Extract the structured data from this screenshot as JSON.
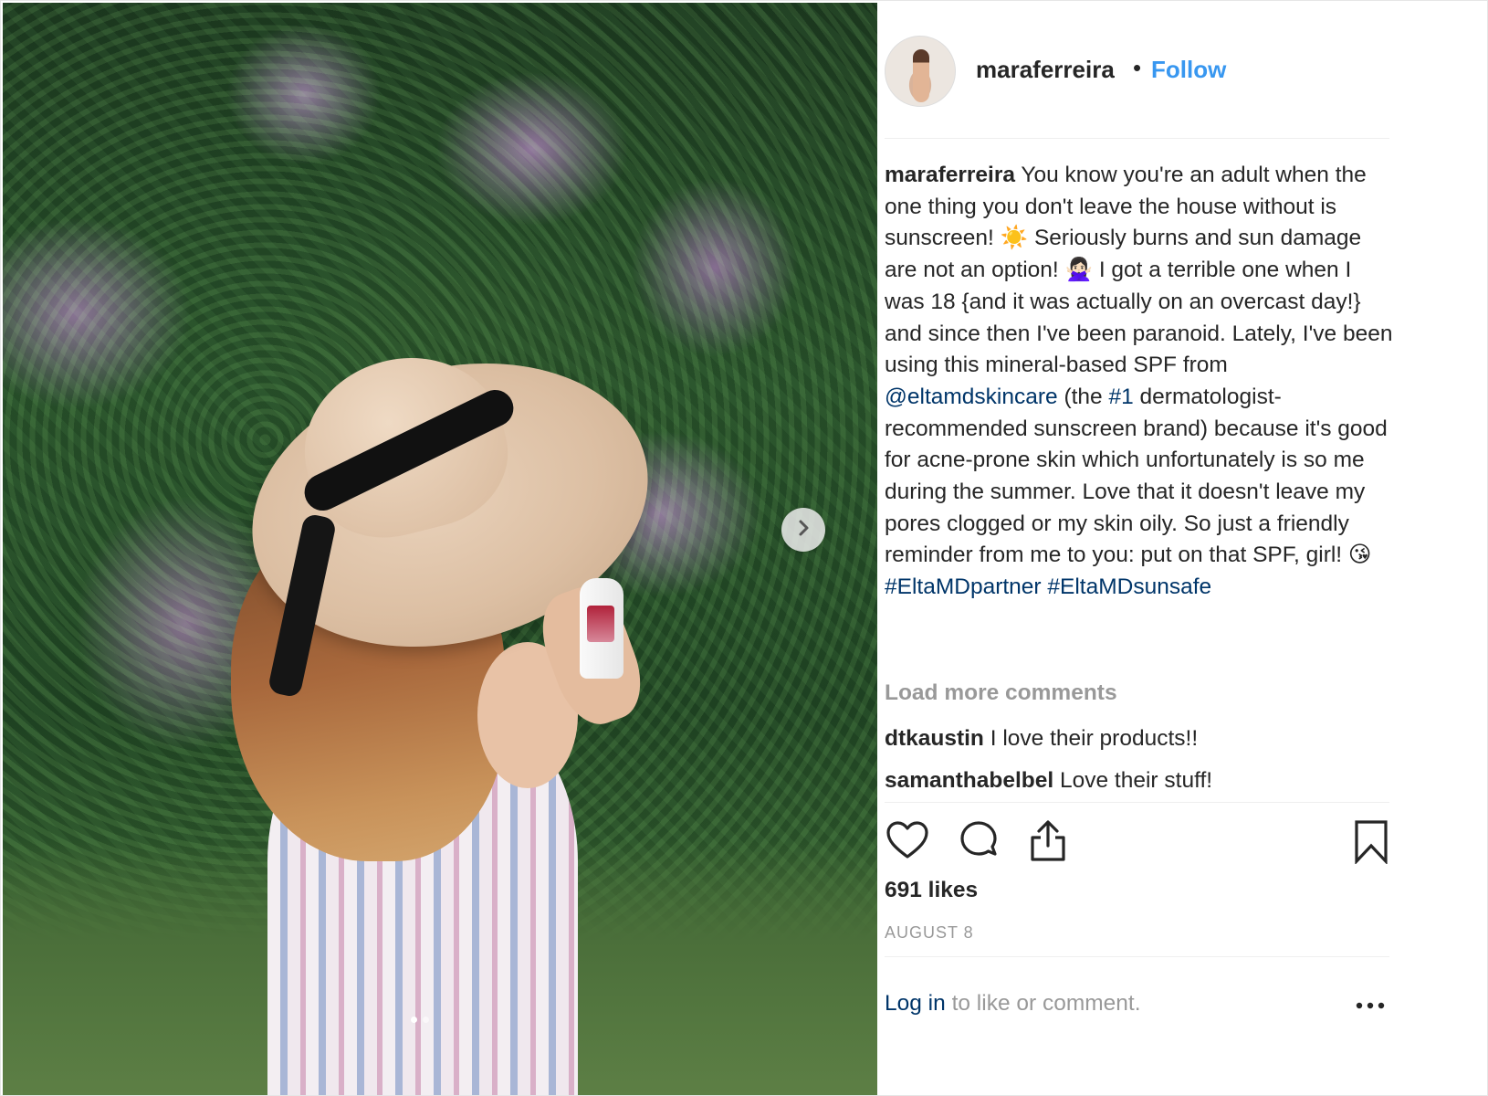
{
  "post": {
    "username": "maraferreira",
    "bullet": "•",
    "follow_label": "Follow",
    "caption": {
      "username": "maraferreira",
      "part1": " You know you're an adult when the one thing you don't leave the house without is sunscreen! ☀️  Seriously burns and sun damage are not an option! 🙅🏻‍♀️ I got a terrible one when I was 18 {and it was actually on an overcast day!} and since then I've been paranoid. Lately, I've been using this mineral-based SPF from ",
      "mention": "@eltamdskincare",
      "part2": " (the ",
      "tag_number": "#1",
      "part3": " dermatologist-recommended sunscreen brand) because it's good for acne-prone skin which unfortunately is so me during the summer. Love that it doesn't leave my pores clogged or my skin oily. So just a friendly reminder from me to you: put on that SPF, girl! 😘 ",
      "hashtag1": "#EltaMDpartner",
      "hashtag2": "#EltaMDsunsafe"
    },
    "load_more_label": "Load more comments",
    "comments": [
      {
        "username": "dtkaustin",
        "text": " I love their products!!"
      },
      {
        "username": "samanthabelbel",
        "text": " Love their stuff!"
      }
    ],
    "likes_text": "691 likes",
    "date_text": "AUGUST 8",
    "login_link": "Log in",
    "login_rest": " to like or comment.",
    "carousel": {
      "current_index": 1,
      "total": 2
    }
  },
  "icons": {
    "like": "heart-icon",
    "comment": "comment-bubble-icon",
    "share": "share-upload-icon",
    "save": "bookmark-icon",
    "next": "chevron-right-icon",
    "more": "more-options-icon"
  },
  "colors": {
    "follow_blue": "#3897f0",
    "link_dark_blue": "#003569",
    "muted_gray": "#999999",
    "text": "#262626"
  }
}
